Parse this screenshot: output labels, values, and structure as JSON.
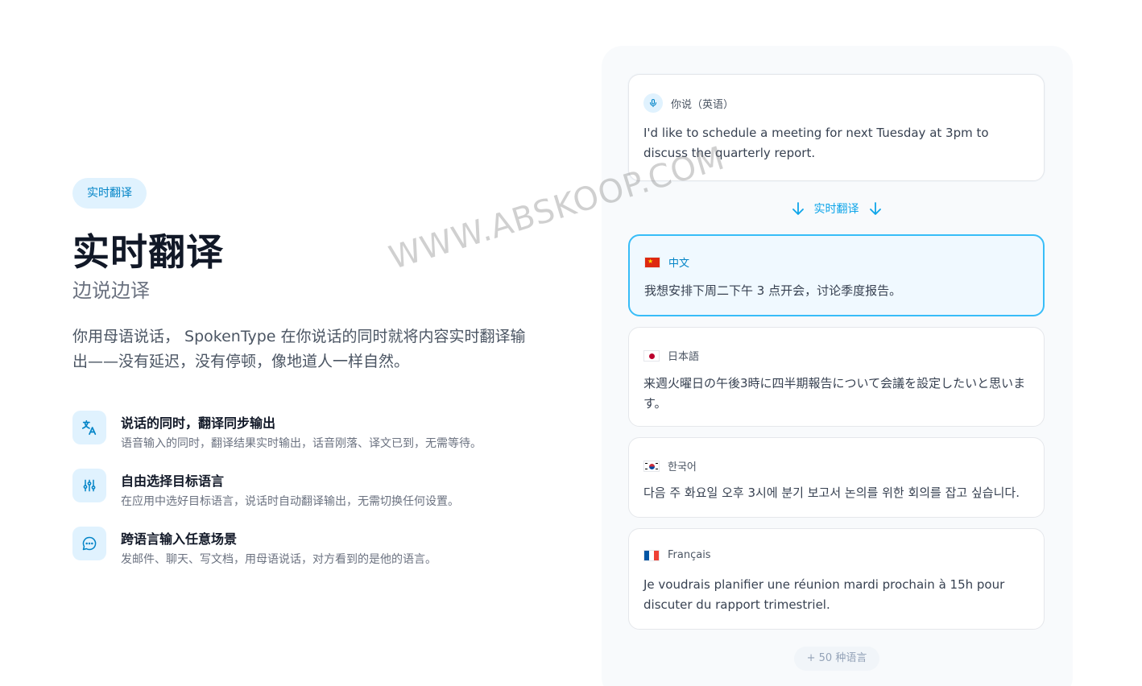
{
  "hero": {
    "badge": "实时翻译",
    "title": "实时翻译",
    "subtitle": "边说边译",
    "description": "你用母语说话， SpokenType 在你说话的同时就将内容实时翻译输出——没有延迟，没有停顿，像地道人一样自然。"
  },
  "features": [
    {
      "icon": "translate-icon",
      "title": "说话的同时，翻译同步输出",
      "desc": "语音输入的同时，翻译结果实时输出，话音刚落、译文已到，无需等待。"
    },
    {
      "icon": "sliders-icon",
      "title": "自由选择目标语言",
      "desc": "在应用中选好目标语言，说话时自动翻译输出，无需切换任何设置。"
    },
    {
      "icon": "chat-bubble-icon",
      "title": "跨语言输入任意场景",
      "desc": "发邮件、聊天、写文档，用母语说话，对方看到的是他的语言。"
    }
  ],
  "demo": {
    "source": {
      "label": "你说（英语）",
      "text": "I'd like to schedule a meeting for next Tuesday at 3pm to discuss the quarterly report."
    },
    "divider_label": "实时翻译",
    "translations": [
      {
        "flag": "china-flag-icon",
        "lang": "中文",
        "text": "我想安排下周二下午 3 点开会，讨论季度报告。"
      },
      {
        "flag": "japan-flag-icon",
        "lang": "日本語",
        "text": "来週火曜日の午後3時に四半期報告について会議を設定したいと思います。"
      },
      {
        "flag": "korea-flag-icon",
        "lang": "한국어",
        "text": "다음 주 화요일 오후 3시에 분기 보고서 논의를 위한 회의를 잡고 싶습니다."
      },
      {
        "flag": "france-flag-icon",
        "lang": "Français",
        "text": "Je voudrais planifier une réunion mardi prochain à 15h pour discuter du rapport trimestriel."
      }
    ],
    "more_label": "+ 50 种语言"
  },
  "watermark": "WWW.ABSKOOP.COM",
  "colors": {
    "accent": "#0ea5e9",
    "accent_light": "#e0f2fe",
    "title": "#111827"
  }
}
